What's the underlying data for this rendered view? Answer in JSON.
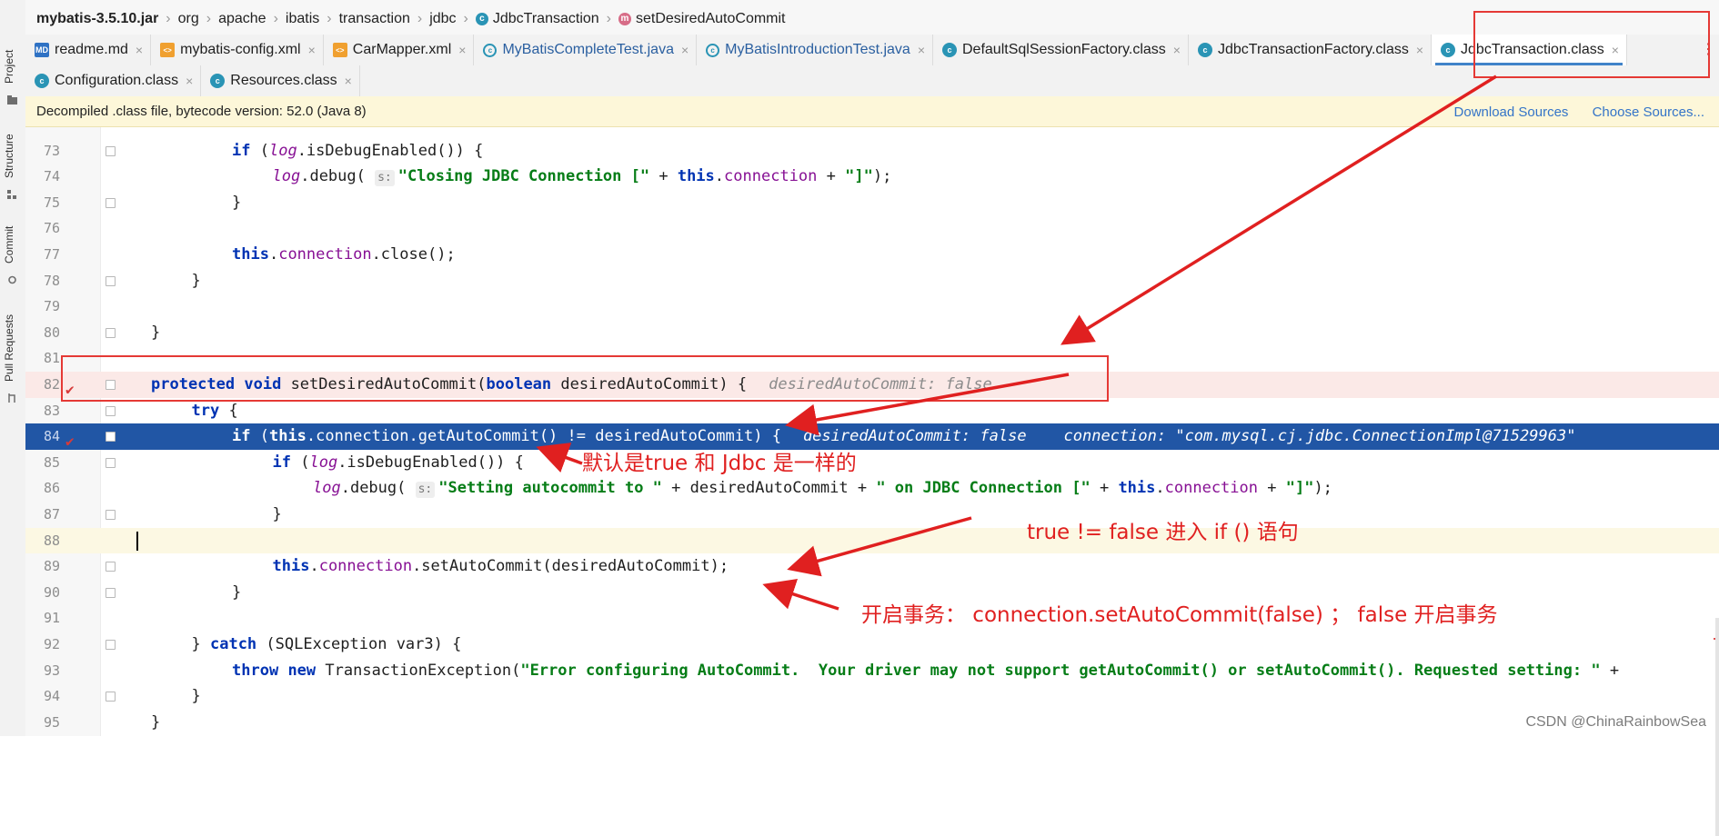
{
  "breadcrumb": [
    {
      "text": "mybatis-3.5.10.jar",
      "icon": ""
    },
    {
      "text": "org",
      "icon": ""
    },
    {
      "text": "apache",
      "icon": ""
    },
    {
      "text": "ibatis",
      "icon": ""
    },
    {
      "text": "transaction",
      "icon": ""
    },
    {
      "text": "jdbc",
      "icon": ""
    },
    {
      "text": "JdbcTransaction",
      "icon": "class-icon"
    },
    {
      "text": "setDesiredAutoCommit",
      "icon": "method-icon"
    }
  ],
  "tabs_row1": [
    {
      "label": "readme.md",
      "icon": "markdown-icon",
      "active": false
    },
    {
      "label": "mybatis-config.xml",
      "icon": "xml-icon",
      "active": false
    },
    {
      "label": "CarMapper.xml",
      "icon": "xml-icon",
      "active": false
    },
    {
      "label": "MyBatisCompleteTest.java",
      "icon": "java-class-icon",
      "active": false
    },
    {
      "label": "MyBatisIntroductionTest.java",
      "icon": "java-class-icon",
      "active": false
    },
    {
      "label": "DefaultSqlSessionFactory.class",
      "icon": "class-icon",
      "active": false
    },
    {
      "label": "JdbcTransactionFactory.class",
      "icon": "class-icon",
      "active": false
    },
    {
      "label": "JdbcTransaction.class",
      "icon": "class-icon",
      "active": true
    }
  ],
  "tabs_row2": [
    {
      "label": "Configuration.class",
      "icon": "class-icon",
      "active": false
    },
    {
      "label": "Resources.class",
      "icon": "class-icon",
      "active": false
    }
  ],
  "banner": {
    "text": "Decompiled .class file, bytecode version: 52.0 (Java 8)",
    "download_sources": "Download Sources",
    "choose_sources": "Choose Sources..."
  },
  "side_tabs": [
    "Project",
    "Structure",
    "Commit",
    "Pull Requests"
  ],
  "code_lines": [
    {
      "num": "73",
      "code": "if (log.isDebugEnabled()) {"
    },
    {
      "num": "74",
      "code": "log.debug( s: \"Closing JDBC Connection [\" + this.connection + \"]\");"
    },
    {
      "num": "75",
      "code": "}"
    },
    {
      "num": "76",
      "code": ""
    },
    {
      "num": "77",
      "code": "this.connection.close();"
    },
    {
      "num": "78",
      "code": "}"
    },
    {
      "num": "79",
      "code": ""
    },
    {
      "num": "80",
      "code": "}"
    },
    {
      "num": "81",
      "code": ""
    },
    {
      "num": "82",
      "code": "protected void setDesiredAutoCommit(boolean desiredAutoCommit) {",
      "inline": "desiredAutoCommit: false"
    },
    {
      "num": "83",
      "code": "try {"
    },
    {
      "num": "84",
      "code": "if (this.connection.getAutoCommit() != desiredAutoCommit) {",
      "inline": "desiredAutoCommit: false    connection: \"com.mysql.cj.jdbc.ConnectionImpl@71529963\""
    },
    {
      "num": "85",
      "code": "if (log.isDebugEnabled()) {"
    },
    {
      "num": "86",
      "code": "log.debug( s: \"Setting autocommit to \" + desiredAutoCommit + \" on JDBC Connection [\" + this.connection + \"]\");"
    },
    {
      "num": "87",
      "code": "}"
    },
    {
      "num": "88",
      "code": ""
    },
    {
      "num": "89",
      "code": "this.connection.setAutoCommit(desiredAutoCommit);"
    },
    {
      "num": "90",
      "code": "}"
    },
    {
      "num": "91",
      "code": ""
    },
    {
      "num": "92",
      "code": "} catch (SQLException var3) {"
    },
    {
      "num": "93",
      "code": "throw new TransactionException(\"Error configuring AutoCommit.  Your driver may not support getAutoCommit() or setAutoCommit(). Requested setting: \" +"
    },
    {
      "num": "94",
      "code": "}"
    },
    {
      "num": "95",
      "code": "}"
    }
  ],
  "annotations": {
    "note1": "默认是true 和 Jdbc 是一样的",
    "note2": "true != false 进入 if () 语句",
    "note3": "开启事务：  connection.setAutoCommit(false) ；  false 开启事务"
  },
  "watermark": "CSDN @ChinaRainbowSea",
  "colors": {
    "selection": "#2156a5",
    "annotation_red": "#e02020",
    "keyword": "#0033b3",
    "string": "#067d17",
    "field": "#871094"
  }
}
